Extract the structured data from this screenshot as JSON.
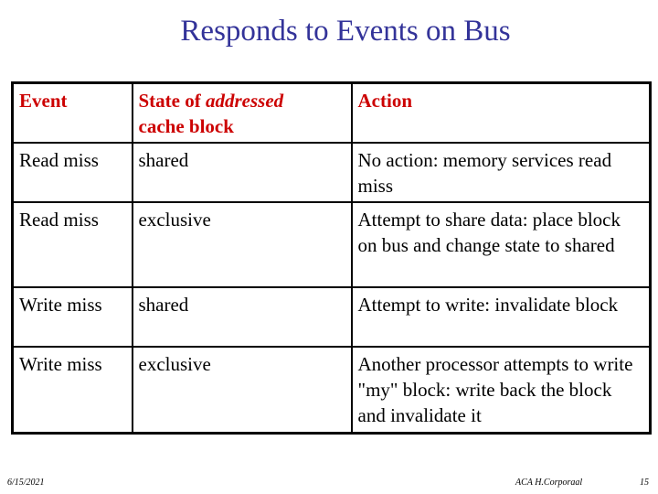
{
  "slide": {
    "title": "Responds to Events on Bus",
    "title_color": "#333399",
    "header_color": "#cc0000"
  },
  "table": {
    "headers": {
      "event": "Event",
      "state_prefix": "State of ",
      "state_italic": "addressed",
      "state_suffix": "cache block",
      "action": "Action"
    },
    "rows": [
      {
        "event": "Read miss",
        "state": "shared",
        "action": "No action: memory services read miss"
      },
      {
        "event": "Read miss",
        "state": "exclusive",
        "action": "Attempt to share data: place block on bus and change state to shared"
      },
      {
        "event": "Write miss",
        "state": "shared",
        "action": "Attempt to write: invalidate block"
      },
      {
        "event": "Write miss",
        "state": "exclusive",
        "action": "Another processor attempts to write \"my\" block: write back the block and invalidate it"
      }
    ]
  },
  "footer": {
    "date": "6/15/2021",
    "author": "ACA H.Corporaal",
    "page": "15"
  }
}
